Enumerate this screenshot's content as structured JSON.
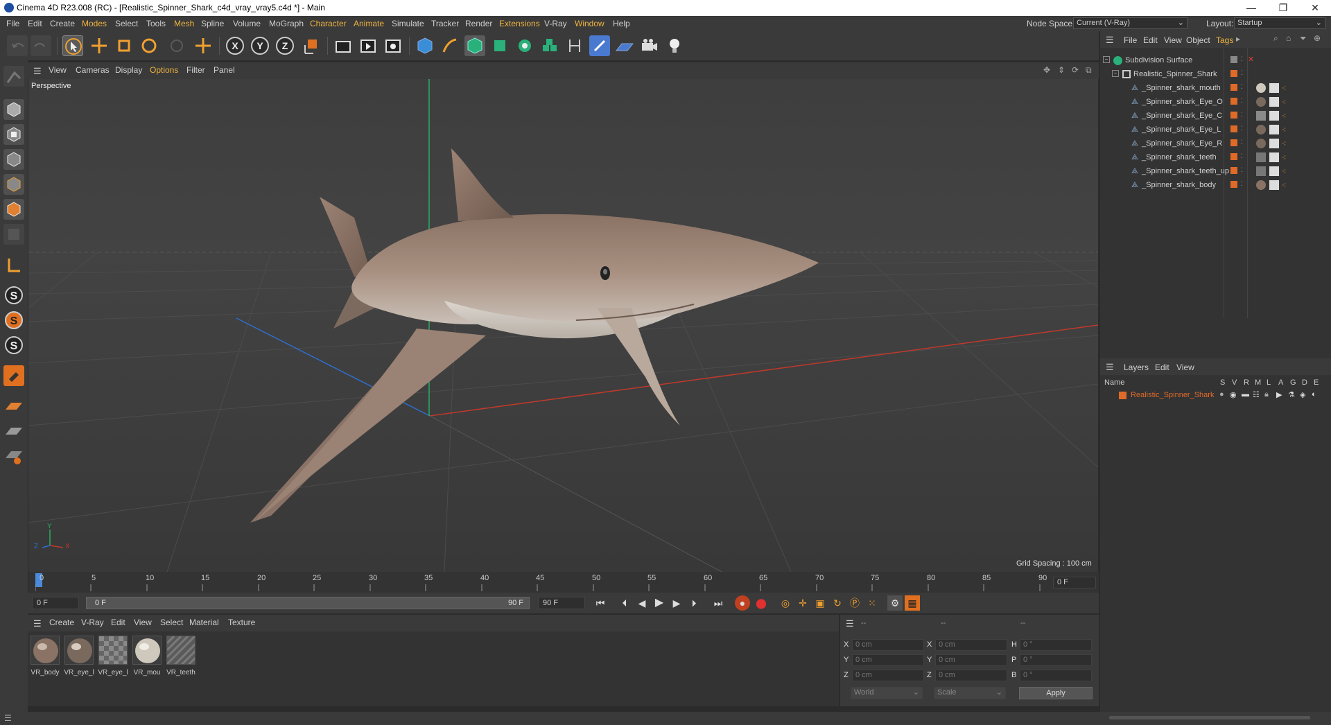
{
  "window": {
    "title": "Cinema 4D R23.008 (RC) - [Realistic_Spinner_Shark_c4d_vray_vray5.c4d *] - Main",
    "minimize": "—",
    "maximize": "❐",
    "close": "✕"
  },
  "menubar": {
    "items": [
      "File",
      "Edit",
      "Create",
      "Modes",
      "Select",
      "Tools",
      "Mesh",
      "Spline",
      "Volume",
      "MoGraph",
      "Character",
      "Animate",
      "Simulate",
      "Tracker",
      "Render",
      "Extensions",
      "V-Ray",
      "Window",
      "Help"
    ],
    "node_space_label": "Node Space:",
    "node_space_value": "Current (V-Ray)",
    "layout_label": "Layout:",
    "layout_value": "Startup"
  },
  "viewport": {
    "menu": [
      "View",
      "Cameras",
      "Display",
      "Options",
      "Filter",
      "Panel"
    ],
    "label": "Perspective",
    "grid_spacing": "Grid Spacing : 100 cm",
    "axis_y": "Y",
    "axis_x": "X",
    "axis_z": "Z"
  },
  "timeline": {
    "ticks": [
      "0",
      "5",
      "10",
      "15",
      "20",
      "25",
      "30",
      "35",
      "40",
      "45",
      "50",
      "55",
      "60",
      "65",
      "70",
      "75",
      "80",
      "85",
      "90"
    ],
    "current_frame_field": "0 F",
    "start_field": "0 F",
    "range_start": "0 F",
    "range_end": "90 F",
    "end_field": "90 F"
  },
  "object_manager": {
    "menu": [
      "File",
      "Edit",
      "View",
      "Object",
      "Tags"
    ],
    "objects": [
      {
        "name": "Subdivision Surface",
        "level": 0
      },
      {
        "name": "Realistic_Spinner_Shark",
        "level": 1
      },
      {
        "name": "_Spinner_shark_mouth",
        "level": 2
      },
      {
        "name": "_Spinner_shark_Eye_O",
        "level": 2
      },
      {
        "name": "_Spinner_shark_Eye_C",
        "level": 2
      },
      {
        "name": "_Spinner_shark_Eye_L",
        "level": 2
      },
      {
        "name": "_Spinner_shark_Eye_R",
        "level": 2
      },
      {
        "name": "_Spinner_shark_teeth",
        "level": 2
      },
      {
        "name": "_Spinner_shark_teeth_up",
        "level": 2
      },
      {
        "name": "_Spinner_shark_body",
        "level": 2
      }
    ]
  },
  "layers": {
    "menu": [
      "Layers",
      "Edit",
      "View"
    ],
    "header_name": "Name",
    "header_cols": [
      "S",
      "V",
      "R",
      "M",
      "L",
      "A",
      "G",
      "D",
      "E"
    ],
    "rows": [
      {
        "name": "Realistic_Spinner_Shark",
        "color": "#e06a28"
      }
    ]
  },
  "material_manager": {
    "menu": [
      "Create",
      "V-Ray",
      "Edit",
      "View",
      "Select",
      "Material",
      "Texture"
    ],
    "materials": [
      {
        "label": "VR_body",
        "kind": "body"
      },
      {
        "label": "VR_eye_l",
        "kind": "eye"
      },
      {
        "label": "VR_eye_l",
        "kind": "checker"
      },
      {
        "label": "VR_mou",
        "kind": "mouth"
      },
      {
        "label": "VR_teeth",
        "kind": "stripes"
      }
    ]
  },
  "coordinates": {
    "header": [
      "--",
      "--",
      "--"
    ],
    "rows": [
      {
        "a": "X",
        "av": "0 cm",
        "b": "X",
        "bv": "0 cm",
        "c": "H",
        "cv": "0 °"
      },
      {
        "a": "Y",
        "av": "0 cm",
        "b": "Y",
        "bv": "0 cm",
        "c": "P",
        "cv": "0 °"
      },
      {
        "a": "Z",
        "av": "0 cm",
        "b": "Z",
        "bv": "0 cm",
        "c": "B",
        "cv": "0 °"
      }
    ],
    "mode1": "World",
    "mode2": "Scale",
    "apply": "Apply"
  },
  "colors": {
    "accent": "#f0b440",
    "orange": "#e06a28",
    "axis_x": "#c0392b",
    "axis_y": "#27ae60",
    "axis_z": "#2e6fd0"
  }
}
